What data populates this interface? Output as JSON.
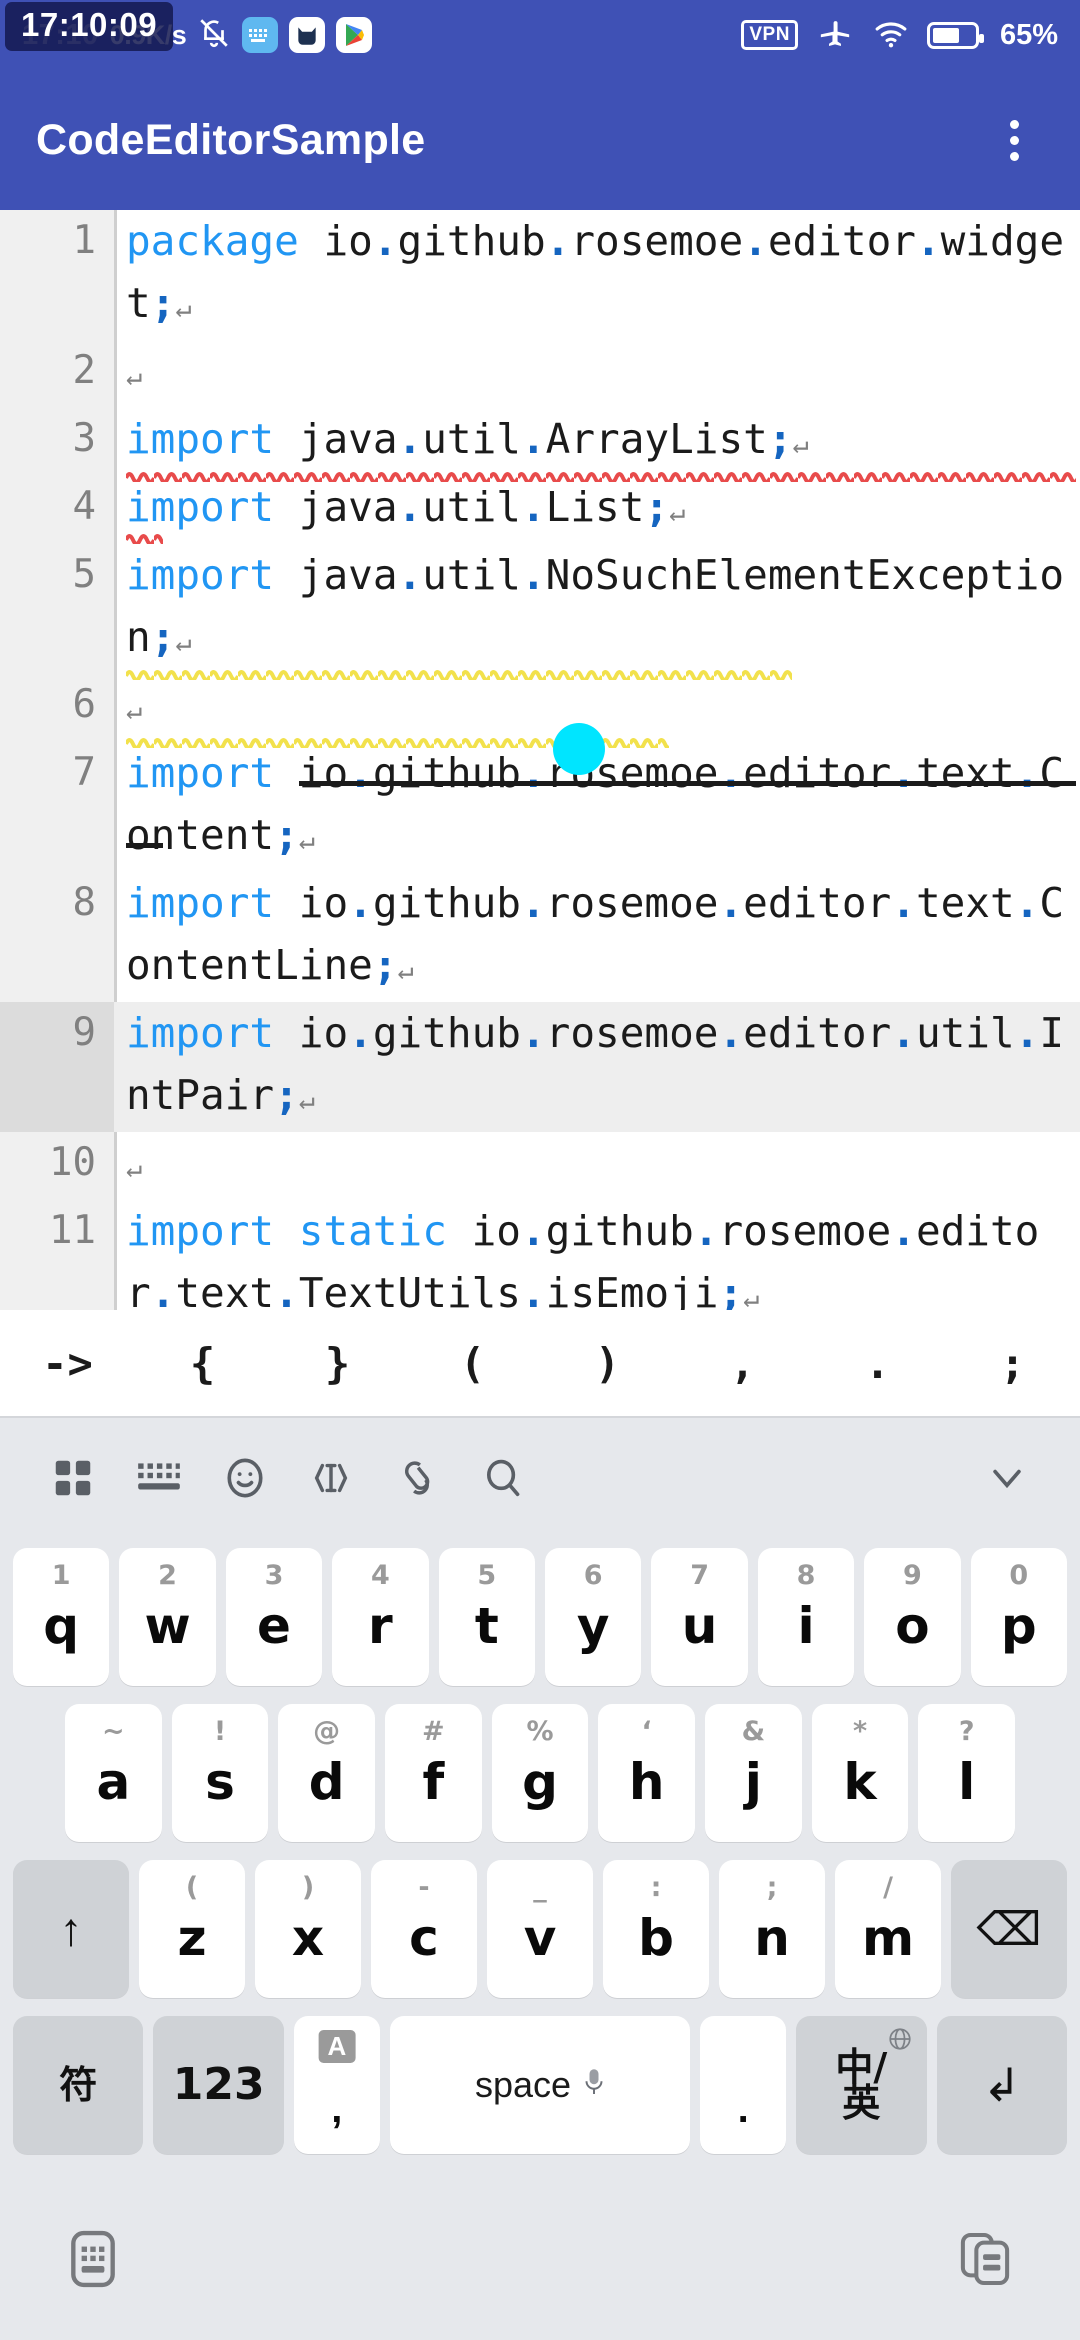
{
  "status_bar": {
    "recording_time": "17:10:09",
    "clock": "17:10",
    "network_speed": "0.9K/s",
    "vpn_label": "VPN",
    "battery_percent": "65%",
    "battery_level": 65,
    "icons": [
      "mute-bell-icon",
      "keyboard-app-icon",
      "cat-app-icon",
      "play-store-icon",
      "vpn-icon",
      "airplane-mode-icon",
      "wifi-icon",
      "battery-icon"
    ],
    "accent_color": "#3f51b5"
  },
  "app_bar": {
    "title": "CodeEditorSample",
    "overflow_label": "more-options"
  },
  "editor": {
    "current_line": 9,
    "cursor_handle_color": "#00e5ff",
    "keyword_color": "#2196f3",
    "punctuation_color": "#1565c0",
    "lines": [
      {
        "num": "1",
        "text": "package io.github.rosemoe.editor.widget;",
        "marker": "red-squiggle"
      },
      {
        "num": "2",
        "text": "",
        "marker": "none"
      },
      {
        "num": "3",
        "text": "import java.util.ArrayList;",
        "marker": "yellow-squiggle"
      },
      {
        "num": "4",
        "text": "import java.util.List;",
        "marker": "yellow-squiggle"
      },
      {
        "num": "5",
        "text": "import java.util.NoSuchElementException;",
        "marker": "strikethrough"
      },
      {
        "num": "6",
        "text": "",
        "marker": "none"
      },
      {
        "num": "7",
        "text": "import io.github.rosemoe.editor.text.Content;",
        "marker": "none"
      },
      {
        "num": "8",
        "text": "import io.github.rosemoe.editor.text.ContentLine;",
        "marker": "none"
      },
      {
        "num": "9",
        "text": "import io.github.rosemoe.editor.util.IntPair;",
        "marker": "none"
      },
      {
        "num": "10",
        "text": "",
        "marker": "none"
      },
      {
        "num": "11",
        "text": "import static io.github.rosemoe.editor.text.TextUtils.isEmoji;",
        "marker": "none"
      }
    ],
    "crlf_glyph": "↵"
  },
  "symbol_bar": {
    "symbols": [
      "->",
      "{",
      "}",
      "(",
      ")",
      ",",
      ".",
      ";"
    ]
  },
  "keyboard_toolbar": {
    "items": [
      {
        "name": "grid-menu-icon"
      },
      {
        "name": "keyboard-icon"
      },
      {
        "name": "emoji-icon"
      },
      {
        "name": "text-cursor-icon"
      },
      {
        "name": "clipboard-icon"
      },
      {
        "name": "search-icon"
      }
    ],
    "collapse": {
      "name": "chevron-down-icon"
    }
  },
  "keyboard": {
    "row1": [
      {
        "hint": "1",
        "key": "q"
      },
      {
        "hint": "2",
        "key": "w"
      },
      {
        "hint": "3",
        "key": "e"
      },
      {
        "hint": "4",
        "key": "r"
      },
      {
        "hint": "5",
        "key": "t"
      },
      {
        "hint": "6",
        "key": "y"
      },
      {
        "hint": "7",
        "key": "u"
      },
      {
        "hint": "8",
        "key": "i"
      },
      {
        "hint": "9",
        "key": "o"
      },
      {
        "hint": "0",
        "key": "p"
      }
    ],
    "row2": [
      {
        "hint": "~",
        "key": "a"
      },
      {
        "hint": "!",
        "key": "s"
      },
      {
        "hint": "@",
        "key": "d"
      },
      {
        "hint": "#",
        "key": "f"
      },
      {
        "hint": "%",
        "key": "g"
      },
      {
        "hint": "‘",
        "key": "h"
      },
      {
        "hint": "&",
        "key": "j"
      },
      {
        "hint": "*",
        "key": "k"
      },
      {
        "hint": "?",
        "key": "l"
      }
    ],
    "row3": [
      {
        "hint": "(",
        "key": "z"
      },
      {
        "hint": ")",
        "key": "x"
      },
      {
        "hint": "-",
        "key": "c"
      },
      {
        "hint": "_",
        "key": "v"
      },
      {
        "hint": ":",
        "key": "b"
      },
      {
        "hint": ";",
        "key": "n"
      },
      {
        "hint": "/",
        "key": "m"
      }
    ],
    "shift_label": "↑",
    "backspace_label": "⌫",
    "row4": {
      "symbols_label": "符",
      "numbers_label": "123",
      "comma_badge": "A",
      "comma_label": ",",
      "space_label": "space",
      "period_label": ".",
      "lang_top": "中/",
      "lang_bottom": "英",
      "enter_label": "↲"
    }
  },
  "nav_bar": {
    "left_icon": "keyboard-switcher-icon",
    "right_icon": "multi-window-icon"
  }
}
